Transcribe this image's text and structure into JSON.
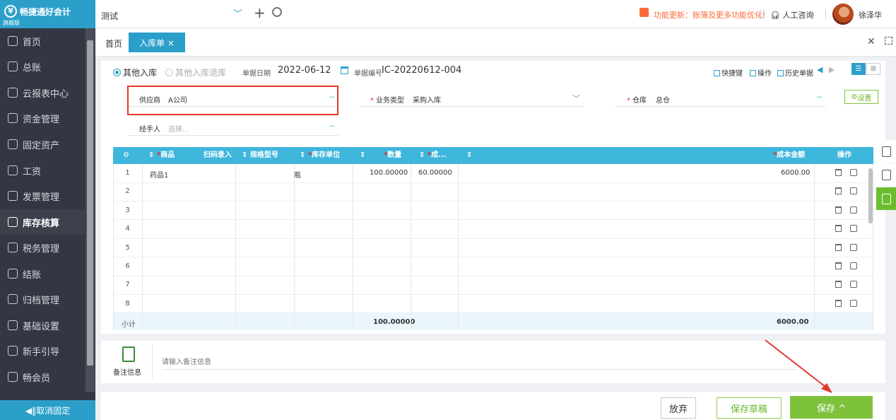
{
  "app": {
    "name": "畅捷通好会计",
    "edition": "旗舰版"
  },
  "sidebar": {
    "items": [
      {
        "label": "首页"
      },
      {
        "label": "总账"
      },
      {
        "label": "云报表中心"
      },
      {
        "label": "资金管理"
      },
      {
        "label": "固定资产"
      },
      {
        "label": "工资"
      },
      {
        "label": "发票管理"
      },
      {
        "label": "库存核算"
      },
      {
        "label": "税务管理"
      },
      {
        "label": "结账"
      },
      {
        "label": "归档管理"
      },
      {
        "label": "基础设置"
      },
      {
        "label": "新手引导"
      },
      {
        "label": "畅会员"
      }
    ],
    "active_index": 7,
    "unpin_label": "◀‖取消固定"
  },
  "topbar": {
    "account": "测试",
    "notice": "功能更新：账簿及更多功能优化!",
    "service": "人工咨询",
    "username": "徐泽华"
  },
  "tabs": {
    "home": "首页",
    "active": "入库单 ×"
  },
  "form": {
    "radio_other_in": "其他入库",
    "radio_other_return": "其他入库退库",
    "date_label": "单据日期",
    "date_value": "2022-06-12",
    "no_label": "单据编号",
    "no_value": "IC-20220612-004",
    "toolbar": {
      "shortcut": "快捷键",
      "operate": "操作",
      "history": "历史单据"
    },
    "supplier_label": "供应商",
    "supplier_value": "A公司",
    "biz_type_label": "业务类型",
    "biz_type_value": "采购入库",
    "warehouse_label": "仓库",
    "warehouse_value": "总仓",
    "settings_label": "设置",
    "handler_label": "经手人",
    "handler_placeholder": "选择..."
  },
  "table": {
    "headers": {
      "product": "商品",
      "scan": "扫码录入",
      "spec": "规格型号",
      "unit": "库存单位",
      "qty": "数量",
      "cost": "成...",
      "amount": "成本金额",
      "ops": "操作"
    },
    "rows": [
      {
        "no": "1",
        "product": "药品1",
        "unit": "瓶",
        "qty": "100.00000",
        "cost": "60.00000",
        "amount": "6000.00"
      },
      {
        "no": "2",
        "product": "",
        "unit": "",
        "qty": "",
        "cost": "",
        "amount": ""
      },
      {
        "no": "3",
        "product": "",
        "unit": "",
        "qty": "",
        "cost": "",
        "amount": ""
      },
      {
        "no": "4",
        "product": "",
        "unit": "",
        "qty": "",
        "cost": "",
        "amount": ""
      },
      {
        "no": "5",
        "product": "",
        "unit": "",
        "qty": "",
        "cost": "",
        "amount": ""
      },
      {
        "no": "6",
        "product": "",
        "unit": "",
        "qty": "",
        "cost": "",
        "amount": ""
      },
      {
        "no": "7",
        "product": "",
        "unit": "",
        "qty": "",
        "cost": "",
        "amount": ""
      },
      {
        "no": "8",
        "product": "",
        "unit": "",
        "qty": "",
        "cost": "",
        "amount": ""
      }
    ],
    "subtotal": {
      "label": "小计",
      "qty": "100.00000",
      "amount": "6000.00"
    }
  },
  "memo": {
    "label": "备注信息",
    "placeholder": "请输入备注信息"
  },
  "buttons": {
    "cancel": "放弃",
    "draft": "保存草稿",
    "save": "保存 ^"
  },
  "colors": {
    "brand": "#2b9fc9",
    "sidebar": "#333743",
    "save": "#7ec23c",
    "highlight": "#e23a2c"
  }
}
